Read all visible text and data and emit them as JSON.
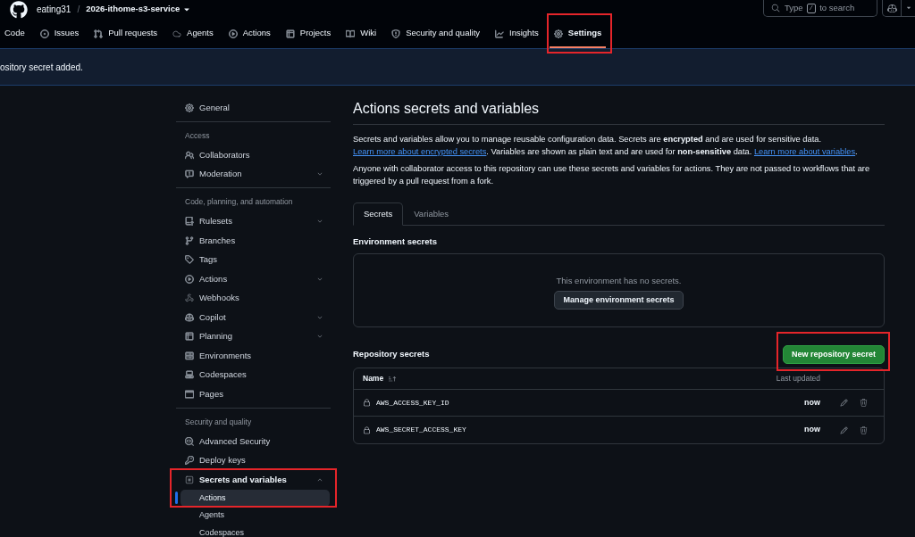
{
  "header": {
    "owner": "eating31",
    "separator": "/",
    "repo": "2026-ithome-s3-service",
    "search": {
      "before_key": "Type",
      "key": "/",
      "after_key": "to search"
    }
  },
  "nav": [
    {
      "label": "Code",
      "selected": false,
      "highlighted": false
    },
    {
      "label": "Issues",
      "selected": false,
      "highlighted": false
    },
    {
      "label": "Pull requests",
      "selected": false,
      "highlighted": false
    },
    {
      "label": "Agents",
      "selected": false,
      "highlighted": false
    },
    {
      "label": "Actions",
      "selected": false,
      "highlighted": false
    },
    {
      "label": "Projects",
      "selected": false,
      "highlighted": false
    },
    {
      "label": "Wiki",
      "selected": false,
      "highlighted": false
    },
    {
      "label": "Security and quality",
      "selected": false,
      "highlighted": false
    },
    {
      "label": "Insights",
      "selected": false,
      "highlighted": false
    },
    {
      "label": "Settings",
      "selected": true,
      "highlighted": true
    }
  ],
  "flash": {
    "message": "ository secret added."
  },
  "sidebar": {
    "sections": [
      {
        "items": [
          {
            "kind": "link",
            "label": "General",
            "highlighted": false
          }
        ]
      },
      {
        "heading": "Access",
        "items": [
          {
            "kind": "link",
            "label": "Collaborators",
            "highlighted": false
          },
          {
            "kind": "group",
            "label": "Moderation",
            "expanded": false,
            "highlighted": false
          }
        ]
      },
      {
        "heading": "Code, planning, and automation",
        "items": [
          {
            "kind": "group",
            "label": "Rulesets",
            "expanded": false,
            "highlighted": false
          },
          {
            "kind": "link",
            "label": "Branches",
            "highlighted": false
          },
          {
            "kind": "link",
            "label": "Tags",
            "highlighted": false
          },
          {
            "kind": "group",
            "label": "Actions",
            "expanded": false,
            "highlighted": false
          },
          {
            "kind": "link",
            "label": "Webhooks",
            "highlighted": false
          },
          {
            "kind": "group",
            "label": "Copilot",
            "expanded": false,
            "highlighted": false
          },
          {
            "kind": "group",
            "label": "Planning",
            "expanded": false,
            "highlighted": false
          },
          {
            "kind": "link",
            "label": "Environments",
            "highlighted": false
          },
          {
            "kind": "link",
            "label": "Codespaces",
            "highlighted": false
          },
          {
            "kind": "link",
            "label": "Pages",
            "highlighted": false
          }
        ]
      },
      {
        "heading": "Security and quality",
        "items": [
          {
            "kind": "link",
            "label": "Advanced Security",
            "highlighted": false
          },
          {
            "kind": "link",
            "label": "Deploy keys",
            "highlighted": false
          },
          {
            "kind": "group",
            "label": "Secrets and variables",
            "expanded": true,
            "highlighted": true,
            "children": [
              {
                "label": "Actions",
                "selected": true
              },
              {
                "label": "Agents",
                "selected": false
              },
              {
                "label": "Codespaces",
                "selected": false
              }
            ]
          }
        ]
      }
    ]
  },
  "main": {
    "title": "Actions secrets and variables",
    "paragraphs": [
      [
        {
          "kind": "text",
          "text": "Secrets and variables allow you to manage reusable configuration data. Secrets are **encrypted** and are used for sensitive data. "
        },
        {
          "kind": "link",
          "text": "Learn more about encrypted secrets"
        },
        {
          "kind": "text",
          "text": ". Variables are shown as plain text and are used for **non-sensitive** data. "
        },
        {
          "kind": "link",
          "text": "Learn more about variables"
        },
        {
          "kind": "text",
          "text": "."
        }
      ],
      [
        {
          "kind": "text",
          "text": "Anyone with collaborator access to this repository can use these secrets and variables for actions. They are not passed to workflows that are triggered by a pull request from a fork."
        }
      ]
    ],
    "tabs": [
      {
        "label": "Secrets",
        "selected": true
      },
      {
        "label": "Variables",
        "selected": false
      }
    ],
    "environment_secrets": {
      "heading": "Environment secrets",
      "empty_message": "This environment has no secrets.",
      "button": "Manage environment secrets"
    },
    "repository_secrets": {
      "heading": "Repository secrets",
      "new_button": {
        "label": "New repository secret",
        "highlighted": true
      },
      "columns": [
        "Name",
        "Last updated"
      ],
      "rows": [
        {
          "name": "AWS_ACCESS_KEY_ID",
          "last_updated": "now"
        },
        {
          "name": "AWS_SECRET_ACCESS_KEY",
          "last_updated": "now"
        }
      ]
    }
  }
}
